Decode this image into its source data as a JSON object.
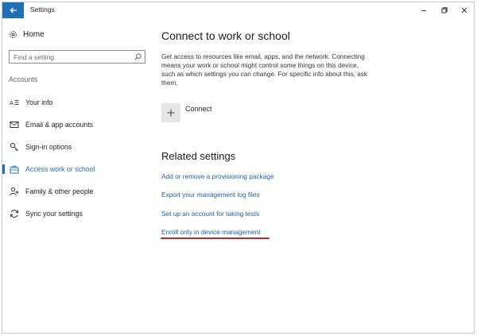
{
  "window": {
    "title": "Settings"
  },
  "sidebar": {
    "home_label": "Home",
    "search_placeholder": "Find a setting",
    "section_label": "Accounts",
    "items": [
      {
        "label": "Your info",
        "icon": "person-card-icon"
      },
      {
        "label": "Email & app accounts",
        "icon": "email-icon"
      },
      {
        "label": "Sign-in options",
        "icon": "key-icon"
      },
      {
        "label": "Access work or school",
        "icon": "briefcase-icon",
        "active": true
      },
      {
        "label": "Family & other people",
        "icon": "person-add-icon"
      },
      {
        "label": "Sync your settings",
        "icon": "sync-icon"
      }
    ]
  },
  "main": {
    "title": "Connect to work or school",
    "description": "Get access to resources like email, apps, and the network. Connecting means your work or school might control some things on this device, such as which settings you can change. For specific info about this, ask them.",
    "connect_label": "Connect",
    "related_title": "Related settings",
    "links": [
      "Add or remove a provisioning package",
      "Export your management log files",
      "Set up an account for taking tests",
      "Enroll only in device management"
    ]
  },
  "colors": {
    "accent": "#1f6fb5",
    "link": "#1f5fa8",
    "annotation_underline": "#c0262d"
  }
}
